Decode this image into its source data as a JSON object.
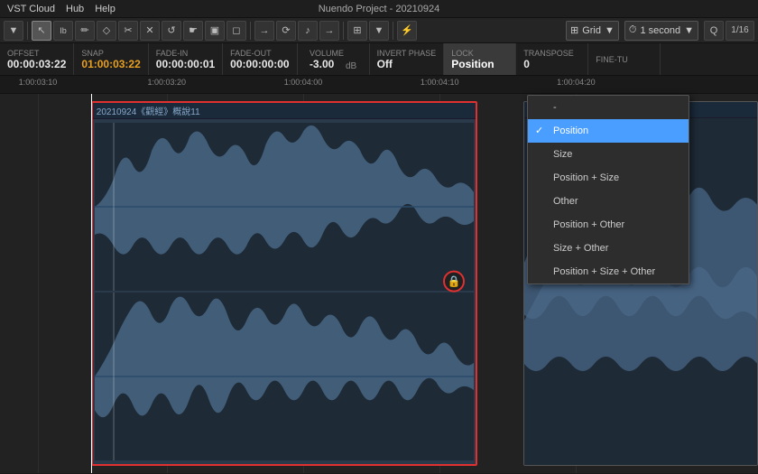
{
  "app": {
    "title": "Nuendo Project - 20210924",
    "menu": [
      "VST Cloud",
      "Hub",
      "Help"
    ]
  },
  "toolbar": {
    "tools": [
      "▼",
      "↖",
      "Ib",
      "✏",
      "◇",
      "✂",
      "✕",
      "↺",
      "☛",
      "▣",
      "◻",
      "→",
      "⟳",
      "♪",
      "→",
      "⊞",
      "▼",
      "⚡",
      "⊞"
    ],
    "grid_label": "Grid",
    "time_label": "1 second",
    "zoom_label": "1/16"
  },
  "info_bar": {
    "offset_label": "Offset",
    "offset_value": "00:00:03:22",
    "snap_label": "Snap",
    "snap_value": "01:00:03:22",
    "fadein_label": "Fade-In",
    "fadein_value": "00:00:00:01",
    "fadeout_label": "Fade-Out",
    "fadeout_value": "00:00:00:00",
    "volume_label": "Volume",
    "volume_value": "-3.00",
    "volume_unit": "dB",
    "invert_label": "Invert Phase",
    "invert_value": "Off",
    "lock_label": "Lock",
    "lock_value": "Position",
    "transpose_label": "Transpose",
    "transpose_value": "0",
    "finetune_label": "Fine-Tu"
  },
  "timeline": {
    "markers": [
      "1:00:03:10",
      "1:00:03:20",
      "1:00:04:00",
      "1:00:04:10",
      "1:00:04:20"
    ]
  },
  "clip": {
    "name": "20210924《觀經》概說11",
    "border_color": "#e03030"
  },
  "dropdown": {
    "title": "Lock",
    "items": [
      {
        "id": "dash",
        "label": "-",
        "selected": false,
        "separator_after": false
      },
      {
        "id": "position",
        "label": "Position",
        "selected": true,
        "separator_after": false
      },
      {
        "id": "size",
        "label": "Size",
        "selected": false,
        "separator_after": false
      },
      {
        "id": "position-size",
        "label": "Position + Size",
        "selected": false,
        "separator_after": false
      },
      {
        "id": "other",
        "label": "Other",
        "selected": false,
        "separator_after": false
      },
      {
        "id": "position-other",
        "label": "Position + Other",
        "selected": false,
        "separator_after": false
      },
      {
        "id": "size-other",
        "label": "Size + Other",
        "selected": false,
        "separator_after": false
      },
      {
        "id": "position-size-other",
        "label": "Position + Size + Other",
        "selected": false,
        "separator_after": false
      }
    ]
  },
  "colors": {
    "selected_bg": "#4a9eff",
    "clip_border": "#e03030",
    "lock_circle_border": "#e03030"
  }
}
